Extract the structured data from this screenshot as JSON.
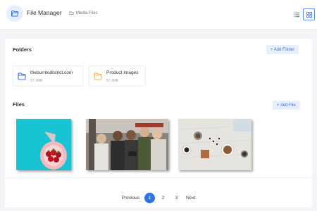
{
  "header": {
    "title": "File Manager",
    "breadcrumb": "Media Files",
    "app_icon": "folder-open-icon",
    "view_list_icon": "list-view-icon",
    "view_grid_icon": "grid-view-icon"
  },
  "folders": {
    "title": "Folders",
    "add_label": "+ Add Folder",
    "items": [
      {
        "name": "theburritodistrict.com",
        "size": "57.3MB",
        "icon": "folder-icon",
        "color": "#3e6fe0"
      },
      {
        "name": "Product Images",
        "size": "57.3MB",
        "icon": "folder-icon",
        "color": "#f2b544"
      }
    ]
  },
  "files": {
    "title": "Files",
    "add_label": "+ Add File",
    "items": [
      {
        "name": "strawberries-photo"
      },
      {
        "name": "group-people-photo"
      },
      {
        "name": "coffee-table-photo"
      }
    ]
  },
  "pagination": {
    "prev": "Previous",
    "pages": [
      "1",
      "2",
      "3"
    ],
    "active": "1",
    "next": "Next"
  },
  "colors": {
    "accent": "#2f74e8",
    "button_bg": "#e8effc",
    "background": "#f3f4f8"
  }
}
